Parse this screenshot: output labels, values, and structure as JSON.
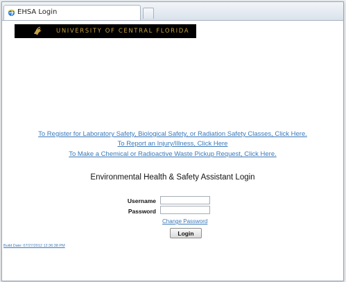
{
  "browser": {
    "tab_title": "EHSA Login"
  },
  "banner": {
    "text": "UNIVERSITY OF CENTRAL FLORIDA"
  },
  "links": {
    "register_classes": "To Register for Laboratory Safety, Biological Safety, or Radiation Safety Classes, Click Here.",
    "report_injury": "To Report an Injury/Illness, Click Here",
    "waste_pickup": "To Make a Chemical or Radioactive Waste Pickup Request, Click Here."
  },
  "login": {
    "heading": "Environmental Health & Safety Assistant Login",
    "username_label": "Username",
    "username_value": "",
    "password_label": "Password",
    "password_value": "",
    "change_password_label": "Change Password",
    "login_button_label": "Login"
  },
  "footer": {
    "build_date": "Build Date: 07/27/2012 12:36:38 PM"
  },
  "colors": {
    "link": "#3a78b8",
    "banner_bg": "#000000",
    "banner_text": "#c8a040"
  },
  "icons": {
    "tab_icon": "ie-page-icon",
    "banner_logo": "ucf-pegasus-logo-icon"
  }
}
